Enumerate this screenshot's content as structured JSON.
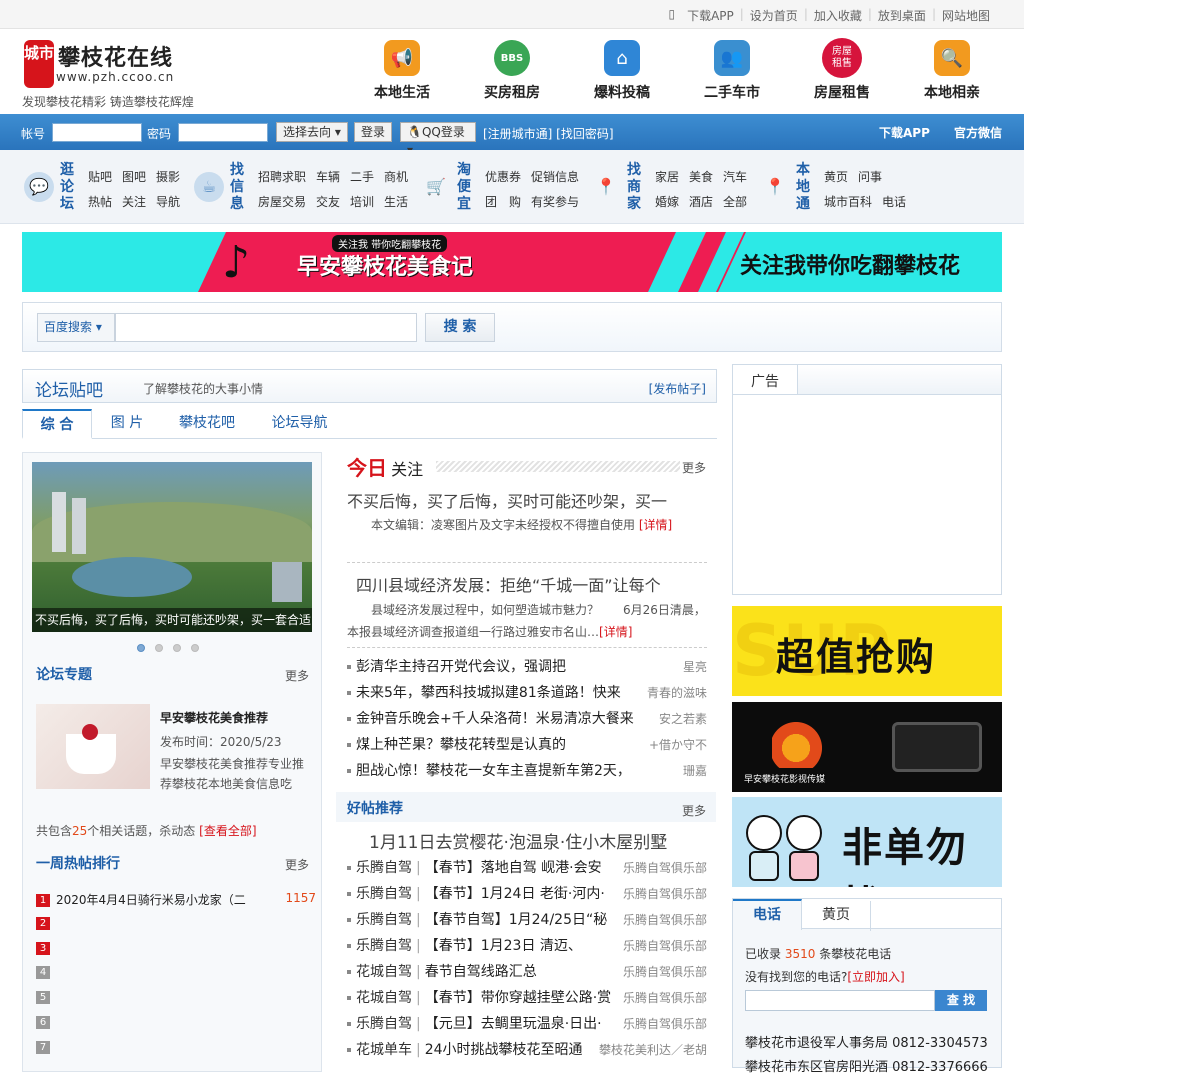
{
  "topbar": {
    "download_app": "下载APP",
    "set_home": "设为首页",
    "bookmark": "加入收藏",
    "to_desktop": "放到桌面",
    "sitemap": "网站地图"
  },
  "logo": {
    "badge": "城市",
    "name": "攀枝花在线",
    "url": "www.pzh.ccoo.cn",
    "slogan": "发现攀枝花精彩 铸造攀枝花辉煌"
  },
  "nav_icons": [
    {
      "label": "本地生活",
      "icon": "megaphone-icon",
      "color": "#f29a1f"
    },
    {
      "label": "买房租房",
      "icon": "bbs-icon",
      "color": "#3aa655"
    },
    {
      "label": "爆料投稿",
      "icon": "home-icon",
      "color": "#2f86d6"
    },
    {
      "label": "二手车市",
      "icon": "users-icon",
      "color": "#3a8fd0"
    },
    {
      "label": "房屋租售",
      "icon": "house-rent-icon",
      "color": "#d6143c",
      "inner": "房屋\n租售"
    },
    {
      "label": "本地相亲",
      "icon": "magnifier-icon",
      "color": "#f29a1f"
    }
  ],
  "login": {
    "account_label": "帐号",
    "password_label": "密码",
    "select_label": "选择去向",
    "login_btn": "登录",
    "qq_btn": "QQ登录",
    "links": "[注册城市通] [找回密码]",
    "download": "下载APP",
    "wechat": "官方微信"
  },
  "nav_groups": [
    {
      "title": "逛论坛",
      "icon": "chat-bubble-icon",
      "row1": [
        "贴吧",
        "图吧",
        "摄影"
      ],
      "row2": [
        "热帖",
        "关注",
        "导航"
      ]
    },
    {
      "title": "找信息",
      "icon": "mug-icon",
      "row1": [
        "招聘求职",
        "车辆",
        "二手",
        "商机"
      ],
      "row2": [
        "房屋交易",
        "交友",
        "培训",
        "生活"
      ]
    },
    {
      "title": "淘便宜",
      "icon": "cart-icon",
      "row1": [
        "优惠券",
        "促销信息"
      ],
      "row2": [
        "团　购",
        "有奖参与"
      ]
    },
    {
      "title": "找商家",
      "icon": "location-pin-icon",
      "row1": [
        "家居",
        "美食",
        "汽车"
      ],
      "row2": [
        "婚嫁",
        "酒店",
        "全部"
      ]
    },
    {
      "title": "本地通",
      "icon": "location-pin-icon",
      "row1": [
        "黄页",
        "问事"
      ],
      "row2": [
        "城市百科",
        "电话"
      ]
    }
  ],
  "banner": {
    "small": "关注我 带你吃翻攀枝花",
    "title": "早安攀枝花美食记",
    "right": "关注我带你吃翻攀枝花",
    "pink": "#ee1d52",
    "cyan": "#2ce9e6"
  },
  "search": {
    "engine": "百度搜索",
    "button": "搜 索"
  },
  "forum": {
    "title": "论坛贴吧",
    "subtitle": "了解攀枝花的大事小情",
    "publish": "[发布帖子]",
    "tabs": [
      "综 合",
      "图 片",
      "攀枝花吧",
      "论坛导航"
    ]
  },
  "slide": {
    "caption": "不买后悔，买了后悔，买时可能还吵架，买一套合适"
  },
  "topic": {
    "title": "论坛专题",
    "more": "更多",
    "item_title": "早安攀枝花美食推荐",
    "date": "发布时间：2020/5/23",
    "desc": "早安攀枝花美食推荐专业推荐攀枝花本地美食信息吃",
    "count_pre": "共包含",
    "count_num": "25",
    "count_post": "个相关话题，杀动态",
    "view_all": "[查看全部]"
  },
  "weekly": {
    "title": "一周热帖排行",
    "more": "更多",
    "items": [
      {
        "n": "1",
        "text": "2020年4月4日骑行米易小龙家（二",
        "count": "1157",
        "color": "#d6141b"
      },
      {
        "n": "2",
        "text": "",
        "count": "",
        "color": "#d6141b"
      },
      {
        "n": "3",
        "text": "",
        "count": "",
        "color": "#d6141b"
      },
      {
        "n": "4",
        "text": "",
        "count": "",
        "color": "#999999"
      },
      {
        "n": "5",
        "text": "",
        "count": "",
        "color": "#999999"
      },
      {
        "n": "6",
        "text": "",
        "count": "",
        "color": "#999999"
      },
      {
        "n": "7",
        "text": "",
        "count": "",
        "color": "#999999"
      }
    ]
  },
  "today": {
    "k": "今日",
    "g": "关注",
    "more": "更多",
    "headline1": "不买后悔，买了后悔，买时可能还吵架，买一",
    "src1": "本文编辑：凌寒图片及文字未经授权不得擅自使用",
    "detail": "[详情]",
    "headline2": "四川县域经济发展：拒绝“千城一面”让每个",
    "src2a": "县域经济发展过程中，如何塑造城市魅力？　　6月26日清晨，",
    "src2b": "本报县域经济调查报道组一行路过雅安市名山…"
  },
  "news": [
    {
      "text": "彭清华主持召开党代会议，强调把",
      "au": "星亮"
    },
    {
      "text": "未来5年，攀西科技城拟建81条道路！快来",
      "au": "青春的滋味"
    },
    {
      "text": "金钟音乐晚会+千人朵洛荷！米易清凉大餐来",
      "au": "安之若素"
    },
    {
      "text": "煤上种芒果？攀枝花转型是认真的",
      "au": "+借か守不"
    },
    {
      "text": "胆战心惊！攀枝花一女车主喜提新车第2天，",
      "au": "珊嘉"
    }
  ],
  "good": {
    "title": "好帖推荐",
    "more": "更多",
    "headline": "1月11日去赏樱花·泡温泉·住小木屋别墅",
    "items": [
      {
        "tag": "乐腾自驾",
        "text": "【春节】落地自驾 岘港·会安",
        "au": "乐腾自驾俱乐部"
      },
      {
        "tag": "乐腾自驾",
        "text": "【春节】1月24日 老街·河内·",
        "au": "乐腾自驾俱乐部"
      },
      {
        "tag": "乐腾自驾",
        "text": "【春节自驾】1月24/25日“秘",
        "au": "乐腾自驾俱乐部"
      },
      {
        "tag": "乐腾自驾",
        "text": "【春节】1月23日 清迈、",
        "au": "乐腾自驾俱乐部"
      },
      {
        "tag": "花城自驾",
        "text": "春节自驾线路汇总",
        "au": "乐腾自驾俱乐部"
      },
      {
        "tag": "花城自驾",
        "text": "【春节】带你穿越挂壁公路·赏",
        "au": "乐腾自驾俱乐部"
      },
      {
        "tag": "乐腾自驾",
        "text": "【元旦】去鲷里玩温泉·日出·",
        "au": "乐腾自驾俱乐部"
      },
      {
        "tag": "花城单车",
        "text": "24小时挑战攀枝花至昭通",
        "au": "攀枝花美利达／老胡"
      }
    ]
  },
  "ads": {
    "title": "广告",
    "ad1": "超值抢购",
    "ad2": "早安攀枝花影视传媒",
    "ad3": "非单勿扰"
  },
  "phone": {
    "tab1": "电话",
    "tab2": "黄页",
    "l1_pre": "已收录",
    "l1_num": "3510",
    "l1_post": "条攀枝花电话",
    "l2_pre": "没有找到您的电话?",
    "l2_link": "[立即加入]",
    "btn": "查 找",
    "e1": "攀枝花市退役军人事务局 0812-3304573",
    "e2": "攀枝花市东区官房阳光酒 0812-3376666"
  }
}
